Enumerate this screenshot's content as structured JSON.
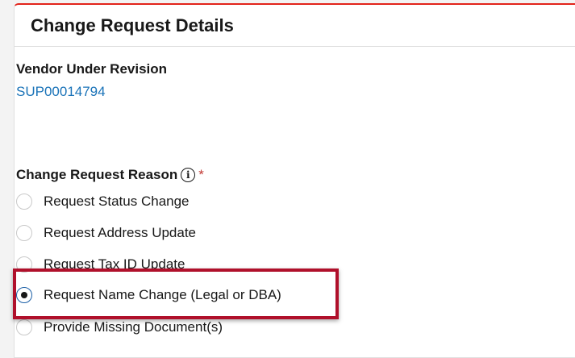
{
  "card": {
    "title": "Change Request Details"
  },
  "vendor": {
    "label": "Vendor Under Revision",
    "value": "SUP00014794"
  },
  "reason": {
    "label": "Change Request Reason",
    "required_marker": "*",
    "info_icon": "info-icon",
    "options": [
      {
        "label": "Request Status Change",
        "checked": false
      },
      {
        "label": "Request Address Update",
        "checked": false
      },
      {
        "label": "Request Tax ID Update",
        "checked": false
      },
      {
        "label": "Request Name Change (Legal or DBA)",
        "checked": true
      },
      {
        "label": "Provide Missing Document(s)",
        "checked": false
      }
    ]
  },
  "colors": {
    "accent_top": "#e2231a",
    "link": "#1a73b8",
    "highlight_border": "#b0102b"
  }
}
